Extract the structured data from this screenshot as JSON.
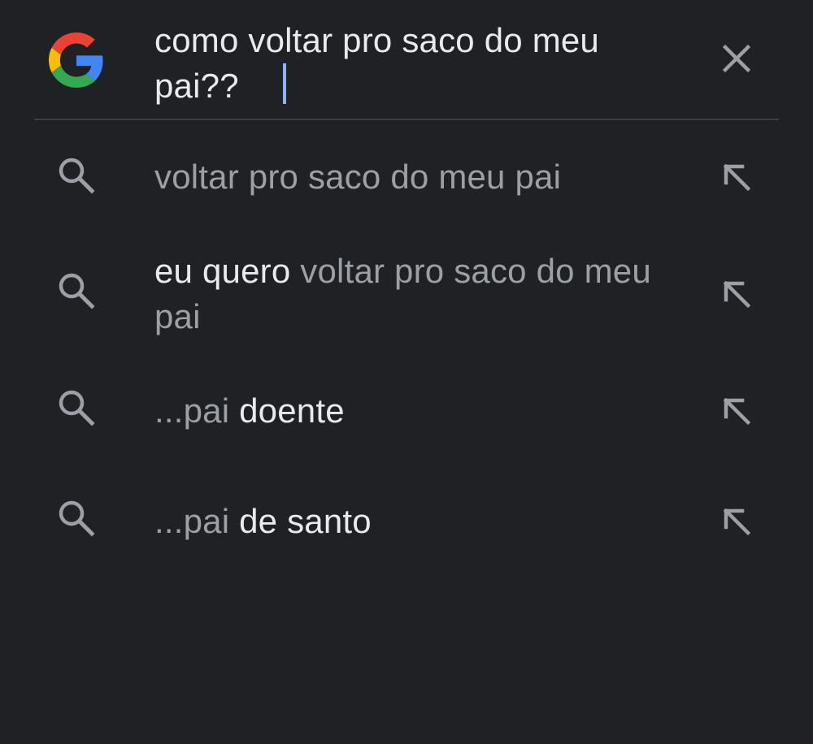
{
  "search": {
    "query": "como voltar pro saco do meu pai??",
    "logo_icon": "google-g-icon",
    "clear_icon": "close-icon",
    "caret_color": "#8ab4f8"
  },
  "colors": {
    "background": "#202124",
    "text_primary": "#e8eaed",
    "text_secondary": "#9aa0a6",
    "divider": "#3c4043"
  },
  "suggestions": [
    {
      "parts": [
        {
          "text": "voltar pro saco do meu pai",
          "style": "gray"
        }
      ],
      "icon": "search-icon",
      "action_icon": "arrow-up-left-icon"
    },
    {
      "parts": [
        {
          "text": "eu quero ",
          "style": "white"
        },
        {
          "text": "voltar pro saco do meu pai",
          "style": "gray"
        }
      ],
      "icon": "search-icon",
      "action_icon": "arrow-up-left-icon"
    },
    {
      "parts": [
        {
          "text": "...pai ",
          "style": "gray"
        },
        {
          "text": "doente",
          "style": "white"
        }
      ],
      "icon": "search-icon",
      "action_icon": "arrow-up-left-icon"
    },
    {
      "parts": [
        {
          "text": "...pai ",
          "style": "gray"
        },
        {
          "text": "de santo",
          "style": "white"
        }
      ],
      "icon": "search-icon",
      "action_icon": "arrow-up-left-icon"
    }
  ]
}
